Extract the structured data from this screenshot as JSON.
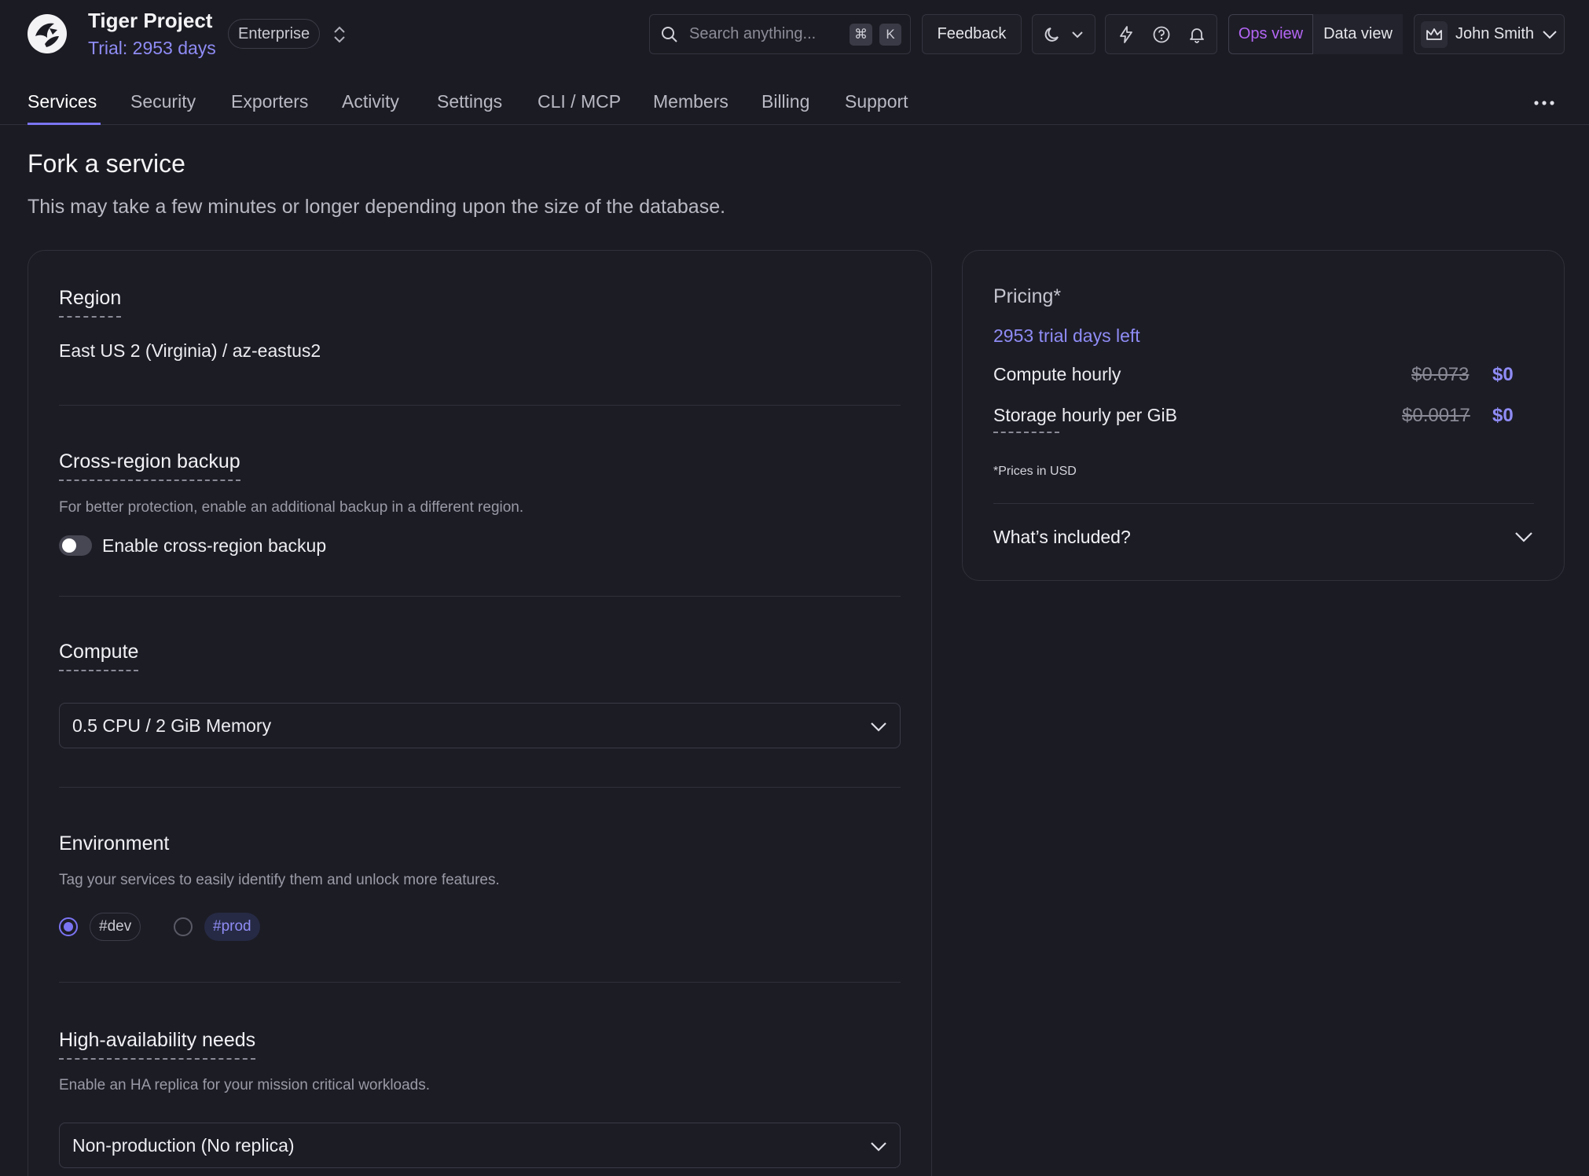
{
  "header": {
    "project_name": "Tiger Project",
    "trial_text": "Trial: 2953 days",
    "plan_badge": "Enterprise",
    "search_placeholder": "Search anything...",
    "search_shortcut_mod": "⌘",
    "search_shortcut_key": "K",
    "feedback_label": "Feedback",
    "ops_view_label": "Ops view",
    "data_view_label": "Data view",
    "user_name": "John Smith",
    "icons": [
      "logo-icon",
      "switch-project-icon",
      "search-icon",
      "moon-icon",
      "chevron-down-icon",
      "lightning-icon",
      "help-icon",
      "bell-icon",
      "crown-icon"
    ],
    "accent_color": "#8f8cf5",
    "ops_view_color": "#b466f4"
  },
  "tabs": [
    {
      "label": "Services",
      "active": true
    },
    {
      "label": "Security"
    },
    {
      "label": "Exporters"
    },
    {
      "label": "Activity"
    },
    {
      "label": "Settings"
    },
    {
      "label": "CLI / MCP"
    },
    {
      "label": "Members"
    },
    {
      "label": "Billing"
    },
    {
      "label": "Support"
    }
  ],
  "page": {
    "title": "Fork a service",
    "subtitle": "This may take a few minutes or longer depending upon the size of the database."
  },
  "form": {
    "region": {
      "title": "Region",
      "value": "East US 2 (Virginia) / az-eastus2"
    },
    "backup": {
      "title": "Cross-region backup",
      "description": "For better protection, enable an additional backup in a different region.",
      "toggle_label": "Enable cross-region backup",
      "enabled": false
    },
    "compute": {
      "title": "Compute",
      "selected": "0.5 CPU / 2 GiB Memory"
    },
    "environment": {
      "title": "Environment",
      "description": "Tag your services to easily identify them and unlock more features.",
      "options": [
        {
          "tag": "#dev",
          "selected": true
        },
        {
          "tag": "#prod",
          "selected": false
        }
      ]
    },
    "ha": {
      "title": "High-availability needs",
      "description": "Enable an HA replica for your mission critical workloads.",
      "selected": "Non-production (No replica)"
    }
  },
  "pricing": {
    "title": "Pricing*",
    "trial_days_left": "2953 trial days left",
    "rows": [
      {
        "label": "Compute hourly",
        "old_price": "$0.073",
        "new_price": "$0"
      },
      {
        "label": "Storage hourly per GiB",
        "old_price": "$0.0017",
        "new_price": "$0"
      }
    ],
    "note": "*Prices in USD",
    "included_label": "What’s included?"
  }
}
